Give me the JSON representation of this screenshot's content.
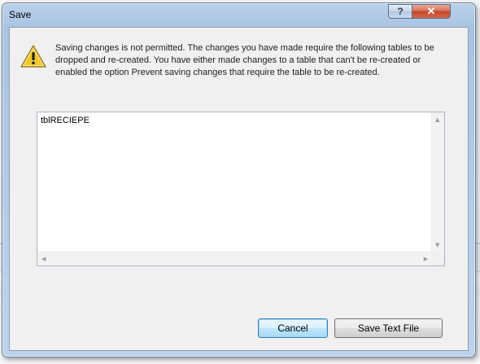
{
  "dialog": {
    "title": "Save",
    "help_glyph": "?",
    "close_glyph": "✕",
    "icon": "warning-icon",
    "message": "Saving changes is not permitted. The changes you have made require the following tables to be dropped and re-created. You have either made changes to a table that can't be re-created or enabled the option Prevent saving changes that require the table to be re-created.",
    "table_list": [
      "tblRECIEPE"
    ],
    "buttons": {
      "cancel_label": "Cancel",
      "save_text_label": "Save Text File"
    }
  },
  "colors": {
    "warning_fill": "#f2c62f",
    "close_button": "#c4442a",
    "default_button_border": "#3c7fb1"
  }
}
